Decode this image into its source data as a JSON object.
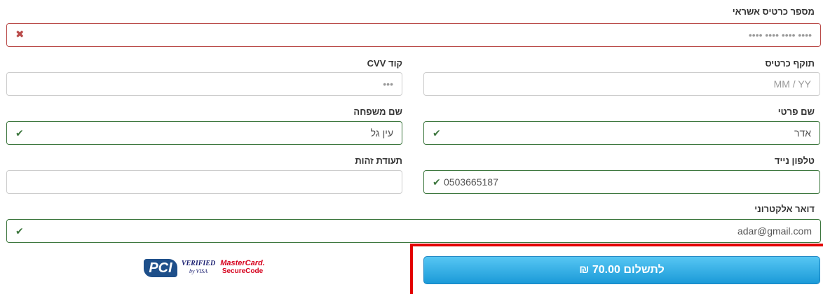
{
  "card_number": {
    "label": "מספר כרטיס אשראי",
    "placeholder": "•••• •••• •••• ••••"
  },
  "cvv": {
    "label": "קוד CVV",
    "placeholder": "•••"
  },
  "expiry": {
    "label": "תוקף כרטיס",
    "placeholder": "MM / YY"
  },
  "last_name": {
    "label": "שם משפחה",
    "value": "עין גל"
  },
  "first_name": {
    "label": "שם פרטי",
    "value": "אדר"
  },
  "id_number": {
    "label": "תעודת זהות",
    "value": ""
  },
  "mobile": {
    "label": "טלפון נייד",
    "value": "0503665187"
  },
  "email": {
    "label": "דואר אלקטרוני",
    "value": "adar@gmail.com"
  },
  "pay_button": {
    "label": "לתשלום 70.00 ₪"
  },
  "badges": {
    "pci": "PCI",
    "visa_line1": "VERIFIED",
    "visa_line2": "by VISA",
    "mc_line1": "MasterCard.",
    "mc_line2": "SecureCode"
  },
  "icons": {
    "valid": "check-icon",
    "invalid": "cross-icon"
  },
  "colors": {
    "valid": "#3c763d",
    "invalid": "#b94a48",
    "button": "#1b9ad8",
    "highlight": "#e30000"
  }
}
